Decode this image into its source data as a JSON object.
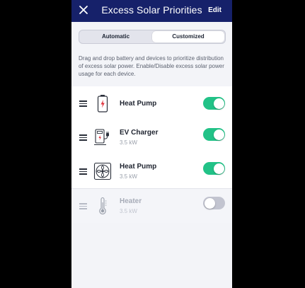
{
  "header": {
    "close_icon": "close-icon",
    "title": "Excess Solar Priorities",
    "edit_label": "Edit"
  },
  "mode_tabs": {
    "automatic": "Automatic",
    "customized": "Customized",
    "selected": "Customized"
  },
  "description": "Drag and drop battery and devices to prioritize distribution of excess solar power. Enable/Disable excess solar power usage for each device.",
  "devices": [
    {
      "icon": "battery-icon",
      "name": "Heat Pump",
      "power": "",
      "enabled": true
    },
    {
      "icon": "ev-charger-icon",
      "name": "EV Charger",
      "power": "3.5 kW",
      "enabled": true
    },
    {
      "icon": "fan-icon",
      "name": "Heat Pump",
      "power": "3.5 kW",
      "enabled": true
    },
    {
      "icon": "thermometer-icon",
      "name": "Heater",
      "power": "3.5 kW",
      "enabled": false
    }
  ],
  "colors": {
    "header_bg": "#16216a",
    "toggle_on": "#22c287",
    "toggle_off": "#c2c4d0",
    "accent_red": "#e0303a"
  }
}
